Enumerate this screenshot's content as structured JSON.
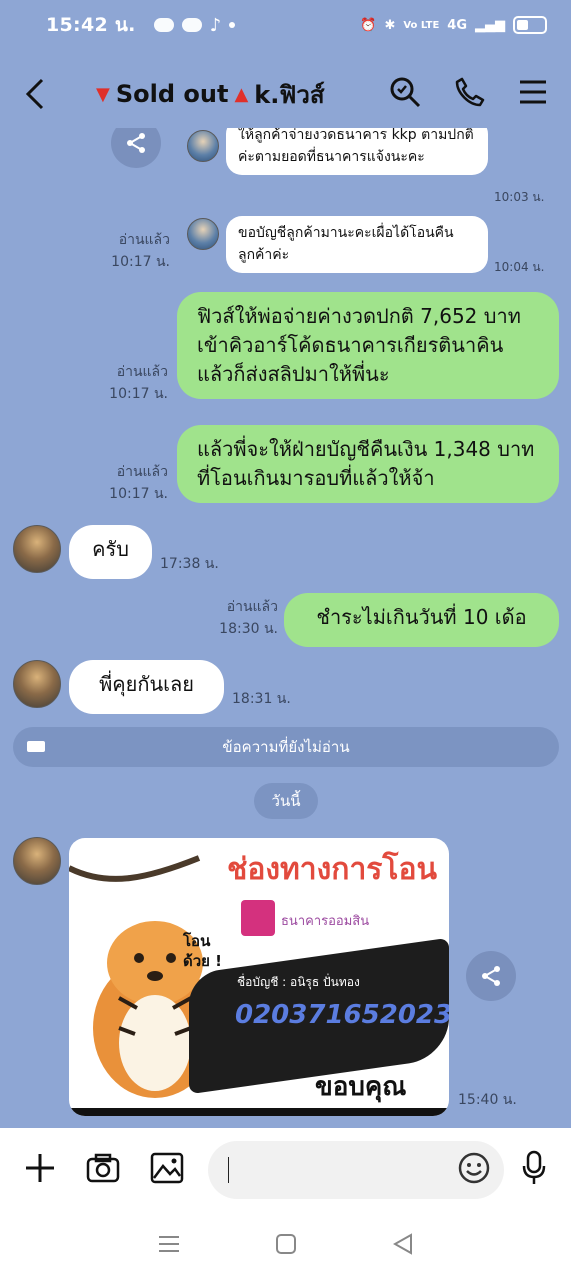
{
  "statusbar": {
    "time": "15:42 น.",
    "network": "4G",
    "volte": "Vo LTE"
  },
  "header": {
    "title_a": "Sold out",
    "title_b": "k.ฟิวส์"
  },
  "messages": {
    "m1": {
      "text": "ให้ลูกค้าจ่ายงวดธนาคาร kkp ตามปกติค่ะตามยอดที่ธนาคารแจ้งนะคะ",
      "time": "10:03 น."
    },
    "m2": {
      "text": "ขอบัญชีลูกค้ามานะคะเผื่อได้โอนคืนลูกค้าค่ะ",
      "time": "10:04 น.",
      "read": "อ่านแล้ว",
      "read_time": "10:17 น."
    },
    "m3": {
      "text": "ฟิวส์ให้พ่อจ่ายค่างวดปกติ 7,652 บาทเข้าคิวอาร์โค้ดธนาคารเกียรตินาคินแล้วก็ส่งสลิปมาให้พี่นะ",
      "read": "อ่านแล้ว",
      "read_time": "10:17 น."
    },
    "m4": {
      "text": "แล้วพี่จะให้ฝ่ายบัญชีคืนเงิน 1,348 บาทที่โอนเกินมารอบที่แล้วให้จ้า",
      "read": "อ่านแล้ว",
      "read_time": "10:17 น."
    },
    "m5": {
      "text": "ครับ",
      "time": "17:38 น."
    },
    "m6": {
      "text": "ชำระไม่เกินวันที่ 10 เด้อ",
      "read": "อ่านแล้ว",
      "read_time": "18:30 น."
    },
    "m7": {
      "text": "พี่คุยกันเลย",
      "time": "18:31 น."
    },
    "m8": {
      "time": "15:40 น.",
      "img_title": "ช่องทางการโอน",
      "img_bank": "ธนาคารออมสิน",
      "img_name": "ชื่อบัญชี : อนิรุธ ปั่นทอง",
      "img_account": "020371652023",
      "img_thanks": "ขอบคุณครับ",
      "img_tiger": "โอน\nด้วย !"
    }
  },
  "unread_divider": "ข้อความที่ยังไม่อ่าน",
  "date_chip": "วันนี้",
  "input": {
    "value": "",
    "placeholder": ""
  },
  "colors": {
    "background": "#8ea6d4",
    "green_bubble": "#a0e38c",
    "white_bubble": "#ffffff",
    "accent_red": "#e0302a"
  }
}
